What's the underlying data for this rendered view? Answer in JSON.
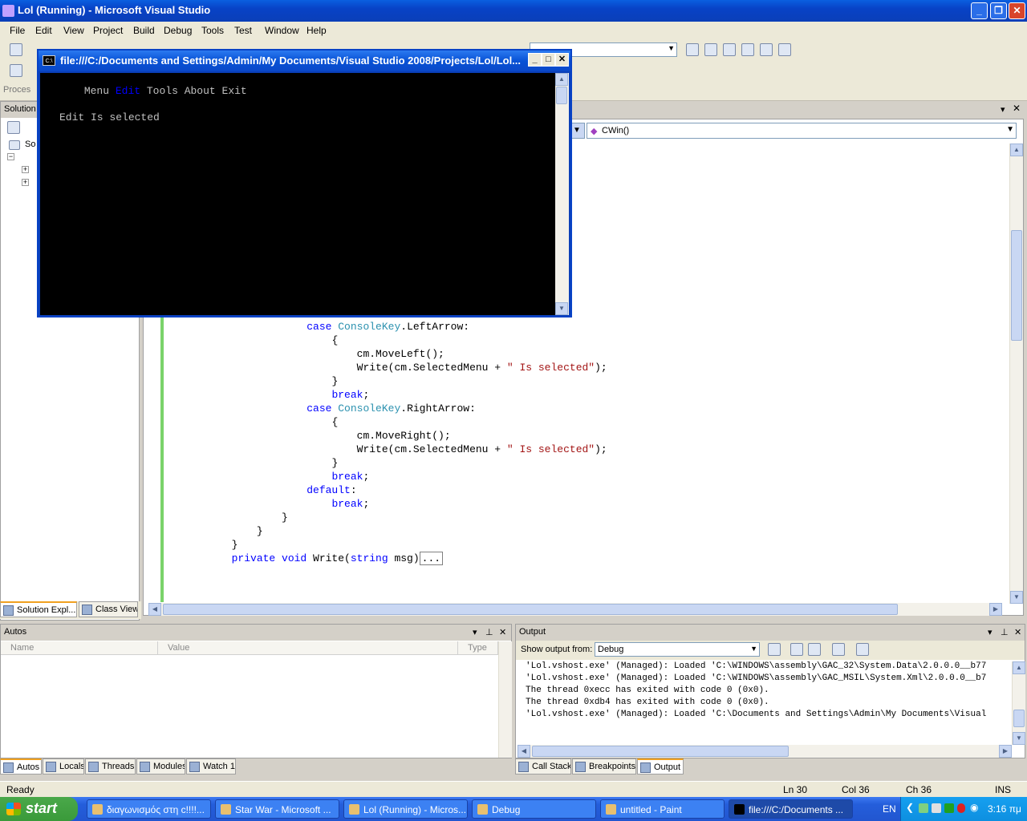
{
  "window": {
    "title": "Lol (Running) - Microsoft Visual Studio"
  },
  "menu": [
    "File",
    "Edit",
    "View",
    "Project",
    "Build",
    "Debug",
    "Tools",
    "Test",
    "Window",
    "Help"
  ],
  "toolbar": {
    "process_label": "Proces"
  },
  "solution_explorer": {
    "header": "Solution",
    "root_label": "So",
    "tabs": [
      "Solution Expl...",
      "Class View"
    ]
  },
  "editor": {
    "member_combo": "CWin()",
    "code": [
      {
        "indent": "              ",
        "parts": [
          [
            "kw",
            "case "
          ],
          [
            "ty",
            "ConsoleKey"
          ],
          [
            "",
            "."
          ],
          [
            "",
            "LeftArrow:"
          ]
        ]
      },
      {
        "indent": "                  ",
        "parts": [
          [
            "",
            "{"
          ]
        ]
      },
      {
        "indent": "                      ",
        "parts": [
          [
            "",
            "cm.MoveLeft();"
          ]
        ]
      },
      {
        "indent": "                      ",
        "parts": [
          [
            "",
            "Write(cm.SelectedMenu + "
          ],
          [
            "st",
            "\" Is selected\""
          ],
          [
            "",
            ");"
          ]
        ]
      },
      {
        "indent": "                  ",
        "parts": [
          [
            "",
            "}"
          ]
        ]
      },
      {
        "indent": "                  ",
        "parts": [
          [
            "kw",
            "break"
          ],
          [
            "",
            ";"
          ]
        ]
      },
      {
        "indent": "              ",
        "parts": [
          [
            "kw",
            "case "
          ],
          [
            "ty",
            "ConsoleKey"
          ],
          [
            "",
            "."
          ],
          [
            "",
            "RightArrow:"
          ]
        ]
      },
      {
        "indent": "                  ",
        "parts": [
          [
            "",
            "{"
          ]
        ]
      },
      {
        "indent": "                      ",
        "parts": [
          [
            "",
            "cm.MoveRight();"
          ]
        ]
      },
      {
        "indent": "                      ",
        "parts": [
          [
            "",
            "Write(cm.SelectedMenu + "
          ],
          [
            "st",
            "\" Is selected\""
          ],
          [
            "",
            ");"
          ]
        ]
      },
      {
        "indent": "                  ",
        "parts": [
          [
            "",
            "}"
          ]
        ]
      },
      {
        "indent": "                  ",
        "parts": [
          [
            "kw",
            "break"
          ],
          [
            "",
            ";"
          ]
        ]
      },
      {
        "indent": "              ",
        "parts": [
          [
            "kw",
            "default"
          ],
          [
            "",
            ":"
          ]
        ]
      },
      {
        "indent": "                  ",
        "parts": [
          [
            "kw",
            "break"
          ],
          [
            "",
            ";"
          ]
        ]
      },
      {
        "indent": "          ",
        "parts": [
          [
            "",
            "}"
          ]
        ]
      },
      {
        "indent": "      ",
        "parts": [
          [
            "",
            "}"
          ]
        ]
      },
      {
        "indent": "  ",
        "parts": [
          [
            "",
            "}"
          ]
        ]
      },
      {
        "indent": "  ",
        "parts": [
          [
            "kw",
            "private void "
          ],
          [
            "",
            "Write("
          ],
          [
            "kw",
            "string "
          ],
          [
            "",
            "msg)"
          ],
          [
            "",
            "..."
          ]
        ]
      }
    ]
  },
  "console": {
    "title": "file:///C:/Documents and Settings/Admin/My Documents/Visual Studio 2008/Projects/Lol/Lol...",
    "icon_text": "C:\\",
    "menu_items": [
      "Menu",
      "Edit",
      "Tools",
      "About",
      "Exit"
    ],
    "selected_item": "Edit",
    "message": "Edit Is selected"
  },
  "autos": {
    "title": "Autos",
    "columns": [
      "Name",
      "Value",
      "Type"
    ],
    "tabs": [
      "Autos",
      "Locals",
      "Threads",
      "Modules",
      "Watch 1"
    ]
  },
  "output": {
    "title": "Output",
    "show_from_label": "Show output from:",
    "show_from_value": "Debug",
    "lines": [
      "'Lol.vshost.exe' (Managed): Loaded 'C:\\WINDOWS\\assembly\\GAC_32\\System.Data\\2.0.0.0__b77",
      "'Lol.vshost.exe' (Managed): Loaded 'C:\\WINDOWS\\assembly\\GAC_MSIL\\System.Xml\\2.0.0.0__b7",
      "The thread 0xecc has exited with code 0 (0x0).",
      "The thread 0xdb4 has exited with code 0 (0x0).",
      "'Lol.vshost.exe' (Managed): Loaded 'C:\\Documents and Settings\\Admin\\My Documents\\Visual"
    ],
    "tabs": [
      "Call Stack",
      "Breakpoints",
      "Output"
    ]
  },
  "status": {
    "ready": "Ready",
    "ln": "Ln 30",
    "col": "Col 36",
    "ch": "Ch 36",
    "ins": "INS"
  },
  "taskbar": {
    "start": "start",
    "tasks": [
      "διαγωνισμός στη c!!!!...",
      "Star War - Microsoft ...",
      "Lol (Running) - Micros...",
      "Debug",
      "untitled - Paint",
      "file:///C:/Documents ..."
    ],
    "lang": "EN",
    "time": "3:16 πμ"
  },
  "colors": {
    "accent": "#0a3fb8",
    "selected_menu": "#0000ff",
    "keyword": "#0000ff",
    "type": "#2b91af",
    "string": "#a31515"
  }
}
